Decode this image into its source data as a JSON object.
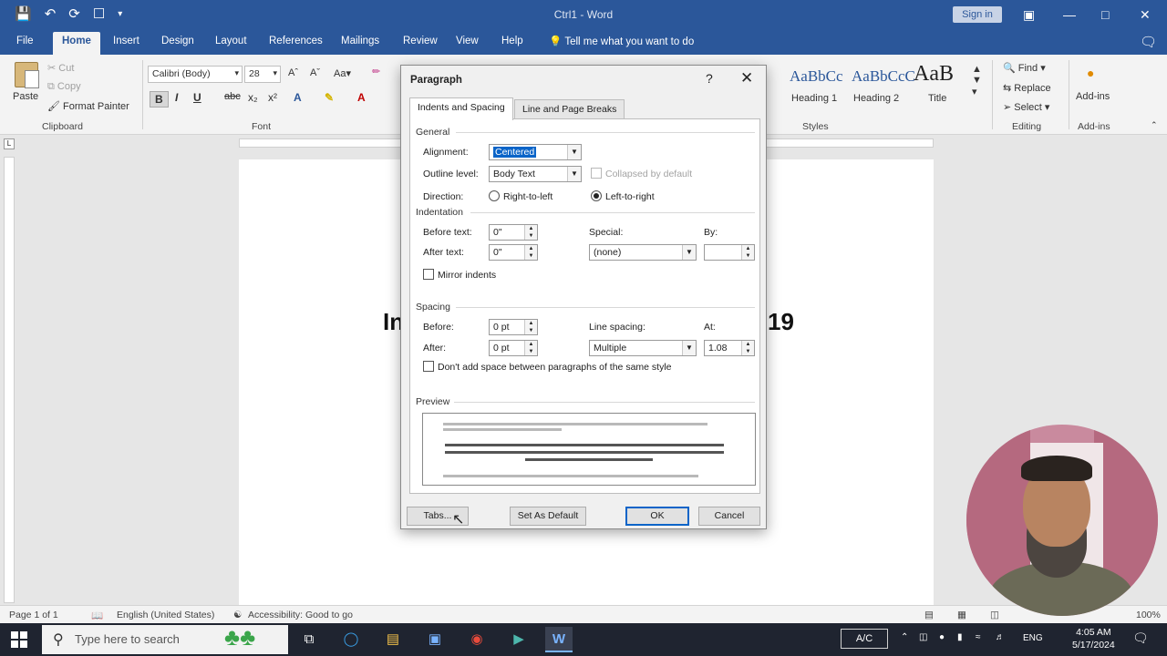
{
  "titlebar": {
    "title": "Ctrl1 - Word",
    "signin": "Sign in",
    "qat_icons": [
      "save-icon",
      "undo-icon",
      "redo-icon",
      "touch-mode-icon",
      "customize-icon"
    ]
  },
  "tabs": [
    "File",
    "Home",
    "Insert",
    "Design",
    "Layout",
    "References",
    "Mailings",
    "Review",
    "View",
    "Help"
  ],
  "active_tab": "Home",
  "tell_me": "Tell me what you want to do",
  "ribbon": {
    "clipboard": {
      "paste": "Paste",
      "cut": "Cut",
      "copy": "Copy",
      "format_painter": "Format Painter",
      "label": "Clipboard"
    },
    "font": {
      "name": "Calibri (Body)",
      "size": "28",
      "label": "Font",
      "bold": "B",
      "italic": "I",
      "underline": "U",
      "strike": "abc",
      "sub": "x₂",
      "sup": "x²"
    },
    "styles": {
      "label": "Styles",
      "items": [
        {
          "sample": "AaBbCc",
          "name": "Heading 1"
        },
        {
          "sample": "AaBbCcC",
          "name": "Heading 2"
        },
        {
          "sample": "AaB",
          "name": "Title"
        }
      ]
    },
    "editing": {
      "find": "Find",
      "replace": "Replace",
      "select": "Select",
      "label": "Editing"
    },
    "addins": {
      "button": "Add-ins",
      "label": "Add-ins"
    }
  },
  "document": {
    "text_left": "In",
    "text_right": "19"
  },
  "dialog": {
    "title": "Paragraph",
    "help": "?",
    "tabs": [
      "Indents and Spacing",
      "Line and Page Breaks"
    ],
    "general": {
      "heading": "General",
      "alignment_label": "Alignment:",
      "alignment_value": "Centered",
      "outline_label": "Outline level:",
      "outline_value": "Body Text",
      "collapsed_label": "Collapsed by default",
      "direction_label": "Direction:",
      "rtl_label": "Right-to-left",
      "ltr_label": "Left-to-right"
    },
    "indentation": {
      "heading": "Indentation",
      "before_label": "Before text:",
      "before_value": "0\"",
      "after_label": "After text:",
      "after_value": "0\"",
      "special_label": "Special:",
      "special_value": "(none)",
      "by_label": "By:",
      "mirror_label": "Mirror indents"
    },
    "spacing": {
      "heading": "Spacing",
      "before_label": "Before:",
      "before_value": "0 pt",
      "after_label": "After:",
      "after_value": "0 pt",
      "line_label": "Line spacing:",
      "line_value": "Multiple",
      "at_label": "At:",
      "at_value": "1.08",
      "dont_add_label": "Don't add space between paragraphs of the same style"
    },
    "preview": {
      "heading": "Preview"
    },
    "buttons": {
      "tabs": "Tabs...",
      "default": "Set As Default",
      "ok": "OK",
      "cancel": "Cancel"
    }
  },
  "statusbar": {
    "page": "Page 1 of 1",
    "language": "English (United States)",
    "accessibility": "Accessibility: Good to go",
    "zoom": "100%"
  },
  "taskbar": {
    "search_placeholder": "Type here to search",
    "ac_label": "A/C",
    "language": "ENG",
    "time": "4:05 AM",
    "date": "5/17/2024"
  }
}
